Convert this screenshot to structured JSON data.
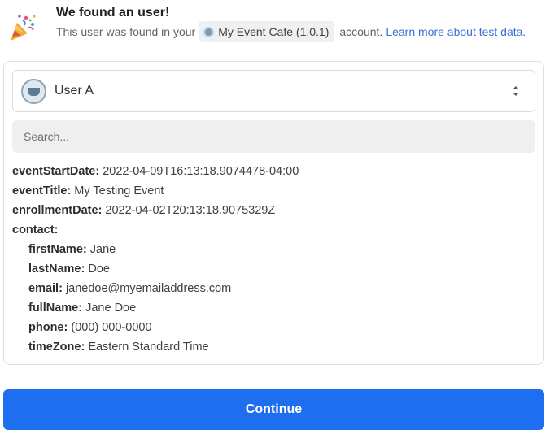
{
  "header": {
    "title": "We found an user!",
    "subline_prefix": "This user was found in your",
    "app_name": "My Event Cafe (1.0.1)",
    "subline_suffix": "account.",
    "learn_link": "Learn more about test data."
  },
  "selector": {
    "label": "User A",
    "avatar_icon": "coffee-cup-icon",
    "arrows_icon": "updown-chevron-icon"
  },
  "search": {
    "placeholder": "Search..."
  },
  "fields": {
    "eventStartDate": {
      "key": "eventStartDate:",
      "value": "2022-04-09T16:13:18.9074478-04:00"
    },
    "eventTitle": {
      "key": "eventTitle:",
      "value": "My Testing Event"
    },
    "enrollmentDate": {
      "key": "enrollmentDate:",
      "value": "2022-04-02T20:13:18.9075329Z"
    },
    "contact": {
      "key": "contact:"
    },
    "firstName": {
      "key": "firstName:",
      "value": "Jane"
    },
    "lastName": {
      "key": "lastName:",
      "value": "Doe"
    },
    "email": {
      "key": "email:",
      "value": "janedoe@myemailaddress.com"
    },
    "fullName": {
      "key": "fullName:",
      "value": "Jane Doe"
    },
    "phone": {
      "key": "phone:",
      "value": "(000) 000-0000"
    },
    "timeZone": {
      "key": "timeZone:",
      "value": "Eastern Standard Time"
    }
  },
  "actions": {
    "continue": "Continue"
  },
  "colors": {
    "primary": "#1e6ef0",
    "link": "#3b6fd6"
  }
}
